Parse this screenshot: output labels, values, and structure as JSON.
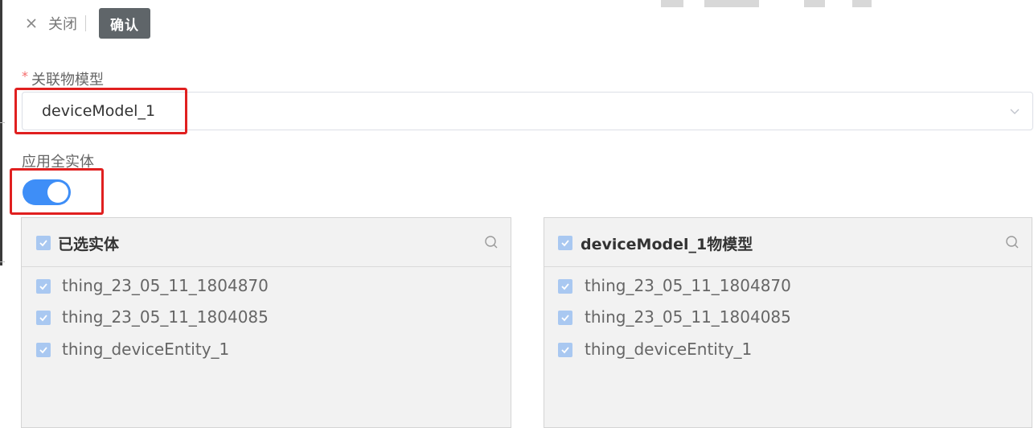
{
  "toolbar": {
    "close_label": "关闭",
    "confirm_label": "确认"
  },
  "model_field": {
    "required_mark": "*",
    "label": "关联物模型",
    "value": "deviceModel_1"
  },
  "apply_all": {
    "label": "应用全实体",
    "enabled": true
  },
  "colors": {
    "accent": "#3e8ef7",
    "highlight": "#e02020",
    "confirm_bg": "#5f6569"
  },
  "left_panel": {
    "title": "已选实体",
    "items": [
      {
        "label": "thing_23_05_11_1804870",
        "checked": true
      },
      {
        "label": "thing_23_05_11_1804085",
        "checked": true
      },
      {
        "label": "thing_deviceEntity_1",
        "checked": true
      }
    ]
  },
  "right_panel": {
    "title": "deviceModel_1物模型",
    "items": [
      {
        "label": "thing_23_05_11_1804870",
        "checked": true
      },
      {
        "label": "thing_23_05_11_1804085",
        "checked": true
      },
      {
        "label": "thing_deviceEntity_1",
        "checked": true
      }
    ]
  }
}
